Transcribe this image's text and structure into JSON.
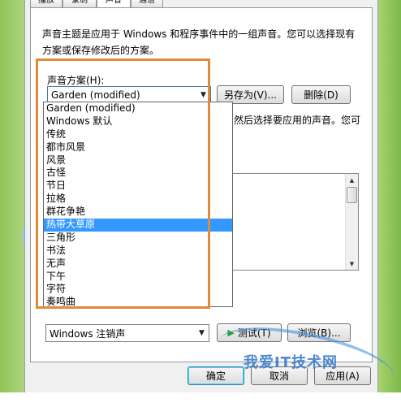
{
  "tabs": [
    "播放",
    "录制",
    "声音",
    "通信"
  ],
  "description": "声音主题是应用于 Windows 和程序事件中的一组声音。您可以选择现有方案或保存修改后的方案。",
  "scheme": {
    "label": "声音方案(H):",
    "selected": "Garden (modified)",
    "save_as_label": "另存为(V)...",
    "delete_label": "删除(D)",
    "options": [
      "Garden (modified)",
      "Windows 默认",
      "传统",
      "都市风景",
      "风景",
      "古怪",
      "节日",
      "拉格",
      "群花争艳",
      "热带大草原",
      "三角形",
      "书法",
      "无声",
      "下午",
      "字符",
      "奏鸣曲"
    ],
    "highlighted_index": 9
  },
  "partial_text_1": "件，然后选择要应用的声音。您可",
  "sound": {
    "selected": "Windows 注销声",
    "test_label": "测试(T)",
    "browse_label": "浏览(B)..."
  },
  "footer": {
    "ok_label": "确定",
    "cancel_label": "取消",
    "apply_label": "应用(A)"
  },
  "watermark": "我爱IT技术网"
}
